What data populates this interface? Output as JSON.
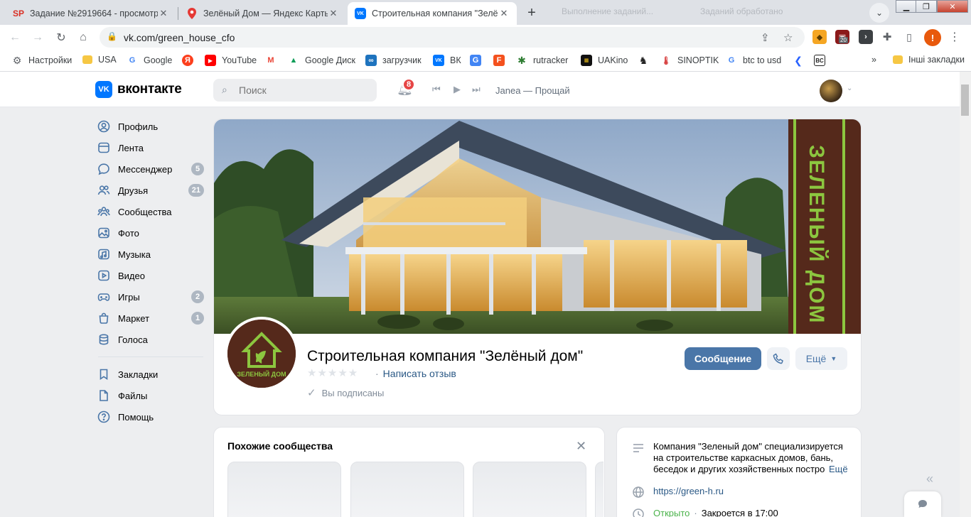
{
  "browser": {
    "tabs": [
      {
        "title": "Задание №2919664 - просмотр",
        "favicon": "SP"
      },
      {
        "title": "Зелёный Дом — Яндекс Карты",
        "favicon": "map-pin"
      },
      {
        "title": "Строительная компания \"Зелё",
        "favicon": "VK"
      }
    ],
    "new_tab": "+",
    "ghost_tabs": [
      "Выполнение заданий...",
      "Заданий обработано"
    ],
    "url": "vk.com/green_house_cfo",
    "extension_badge": "20",
    "profile_initial": "!",
    "bookmarks": [
      "Настройки",
      "USA",
      "Google",
      "",
      "YouTube",
      "",
      "Google Диск",
      "загрузчик",
      "ВК",
      "",
      "",
      "rutracker",
      "UAKino",
      "",
      "SINOPTIK",
      "btc to usd",
      "",
      ""
    ],
    "bookmarks_overflow": "»",
    "other_bookmarks": "Інші закладки"
  },
  "vk": {
    "logo_text": "вконтакте",
    "logo_mark": "VK",
    "search_placeholder": "Поиск",
    "notifications_count": "8",
    "now_playing": "Janea — Прощай",
    "sidebar": [
      {
        "label": "Профиль",
        "count": ""
      },
      {
        "label": "Лента",
        "count": ""
      },
      {
        "label": "Мессенджер",
        "count": "5"
      },
      {
        "label": "Друзья",
        "count": "21"
      },
      {
        "label": "Сообщества",
        "count": ""
      },
      {
        "label": "Фото",
        "count": ""
      },
      {
        "label": "Музыка",
        "count": ""
      },
      {
        "label": "Видео",
        "count": ""
      },
      {
        "label": "Игры",
        "count": "2"
      },
      {
        "label": "Маркет",
        "count": "1"
      },
      {
        "label": "Голоса",
        "count": ""
      },
      {
        "label": "Закладки",
        "count": ""
      },
      {
        "label": "Файлы",
        "count": ""
      },
      {
        "label": "Помощь",
        "count": ""
      }
    ],
    "community": {
      "name": "Строительная компания \"Зелёный дом\"",
      "cover_brand": "ЗЕЛЕНЫЙ ДОМ",
      "avatar_text": "ЗЕЛЕНЫЙ ДОМ",
      "stars": "★★★★★",
      "rating": 0,
      "write_review": "Написать отзыв",
      "subscribed": "Вы подписаны",
      "message_button": "Сообщение",
      "more_button": "Ещё"
    },
    "similar": {
      "title": "Похожие сообщества"
    },
    "info": {
      "description": "Компания \"Зеленый дом\" специализируется на строительстве каркасных домов, бань, беседок и других хозяйственных построек.",
      "description_more": "Ещё",
      "website": "https://green-h.ru",
      "status_open": "Открыто",
      "status_closes": "Закроется в 17:00"
    },
    "colors": {
      "accent": "#4a76a8",
      "brand_brown": "#55291b",
      "brand_green": "#8cc63f"
    }
  }
}
